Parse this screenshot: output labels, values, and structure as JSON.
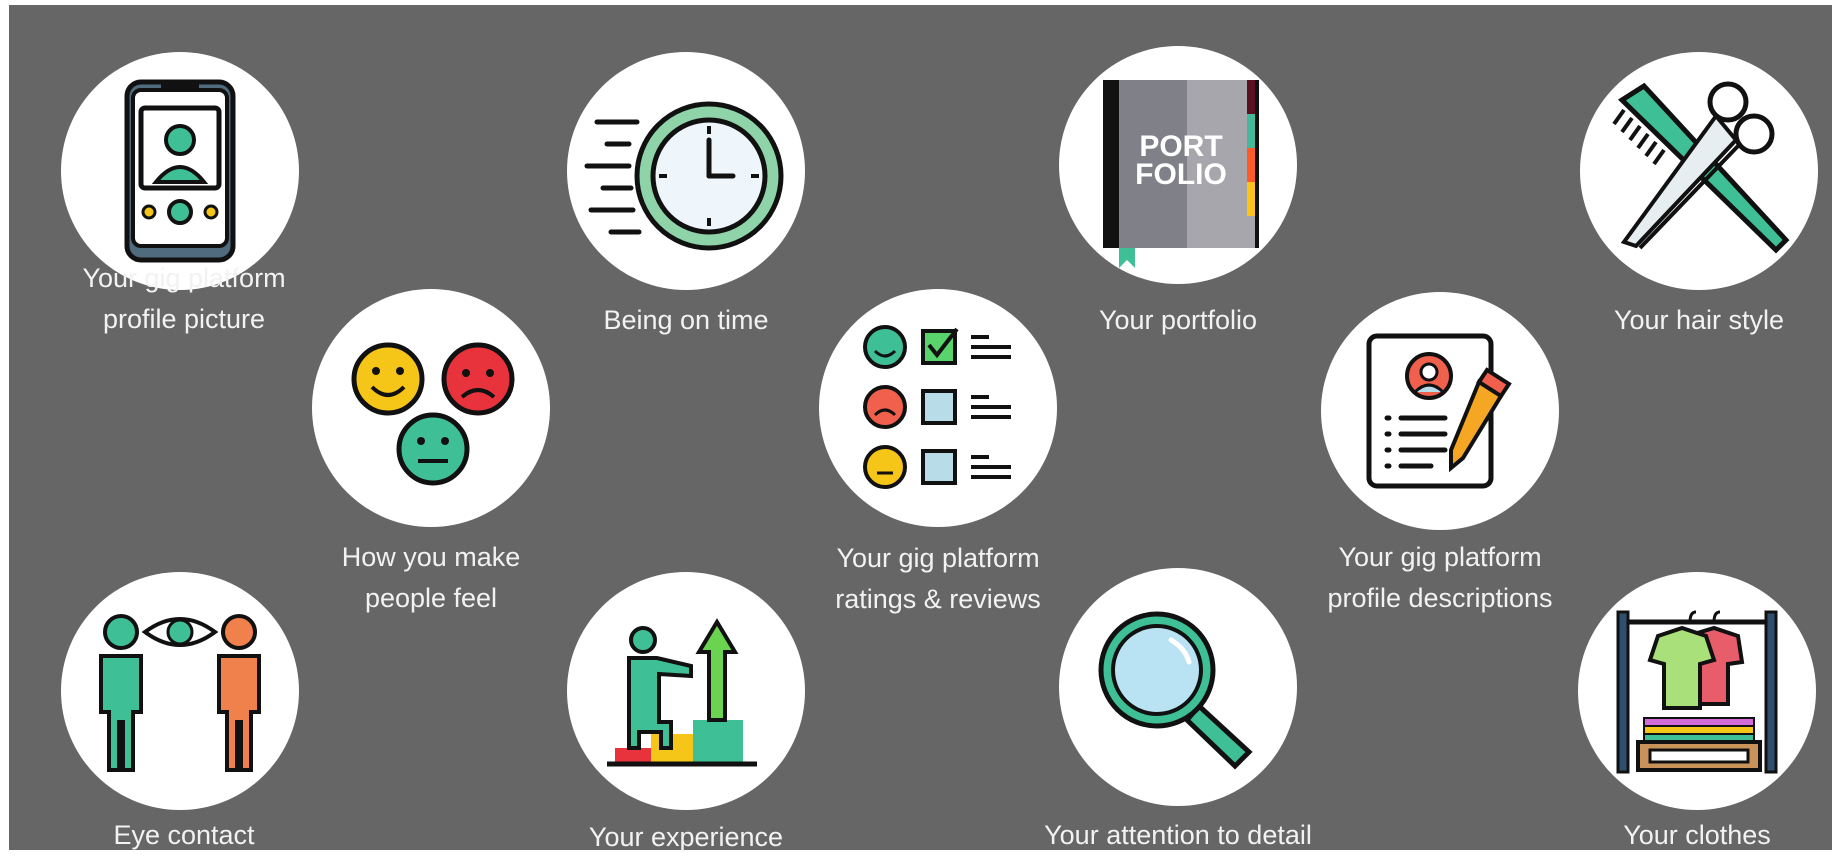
{
  "background_color": "#666666",
  "items": [
    {
      "id": "profile-picture",
      "icon": "smartphone-profile-icon",
      "label": "Your gig platform profile picture",
      "label_lines": [
        "Your gig platform",
        "profile picture"
      ]
    },
    {
      "id": "feelings",
      "icon": "emotion-faces-icon",
      "label": "How you make people feel",
      "label_lines": [
        "How you make",
        "people feel"
      ]
    },
    {
      "id": "on-time",
      "icon": "fast-clock-icon",
      "label": "Being on time",
      "label_lines": [
        "Being on time"
      ]
    },
    {
      "id": "ratings",
      "icon": "rating-checklist-icon",
      "label": "Your gig platform ratings & reviews",
      "label_lines": [
        "Your gig platform",
        "ratings & reviews"
      ]
    },
    {
      "id": "portfolio",
      "icon": "portfolio-book-icon",
      "label": "Your portfolio",
      "label_lines": [
        "Your portfolio"
      ],
      "icon_text": [
        "PORT",
        "FOLIO"
      ]
    },
    {
      "id": "descriptions",
      "icon": "profile-document-pencil-icon",
      "label": "Your gig platform profile descriptions",
      "label_lines": [
        "Your gig platform",
        "profile descriptions"
      ]
    },
    {
      "id": "hair-style",
      "icon": "comb-scissors-icon",
      "label": "Your hair style",
      "label_lines": [
        "Your hair style"
      ]
    },
    {
      "id": "eye-contact",
      "icon": "eye-contact-icon",
      "label": "Eye contact",
      "label_lines": [
        "Eye contact"
      ]
    },
    {
      "id": "experience",
      "icon": "career-steps-icon",
      "label": "Your experience",
      "label_lines": [
        "Your experience"
      ]
    },
    {
      "id": "attention",
      "icon": "magnifying-glass-icon",
      "label": "Your attention to detail",
      "label_lines": [
        "Your attention to detail"
      ]
    },
    {
      "id": "clothes",
      "icon": "clothes-rack-icon",
      "label": "Your clothes",
      "label_lines": [
        "Your clothes"
      ]
    }
  ]
}
